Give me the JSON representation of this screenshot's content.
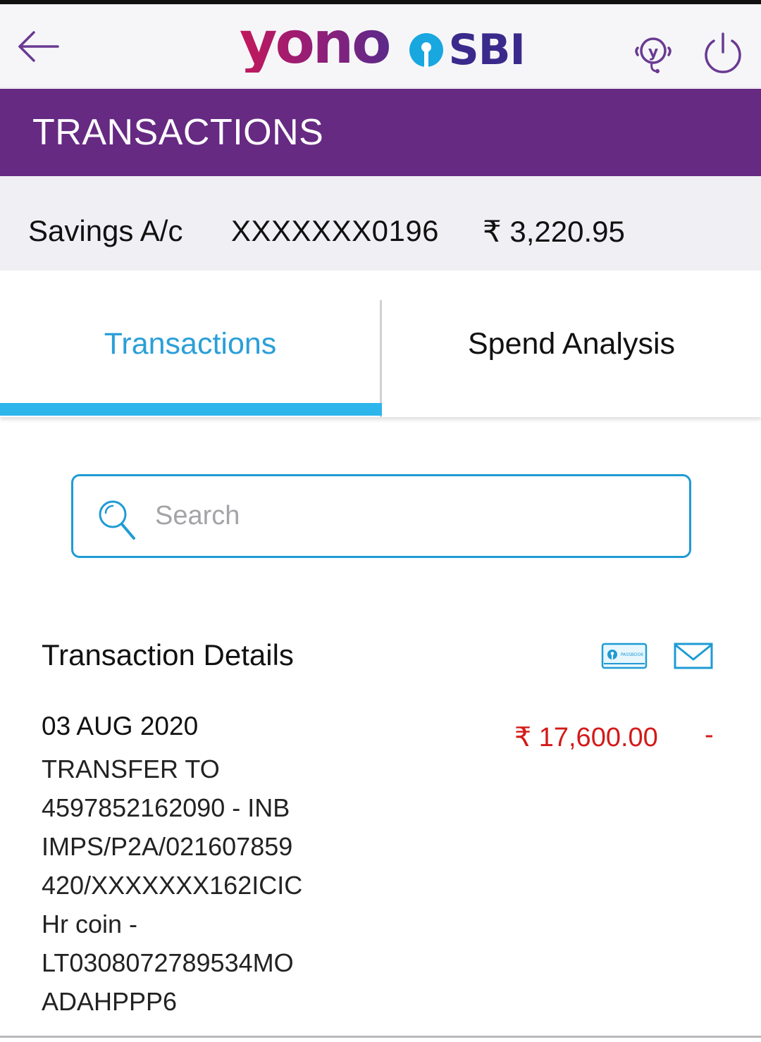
{
  "header": {
    "logo_text": "yono",
    "bank_text": "SBI",
    "icons": [
      "back-arrow-icon",
      "yono-help-icon",
      "power-icon"
    ],
    "accent_color": "#662a82"
  },
  "page_title": "TRANSACTIONS",
  "account": {
    "type": "Savings A/c",
    "number": "XXXXXXX0196",
    "balance": "₹ 3,220.95"
  },
  "tabs": [
    {
      "label": "Transactions",
      "active": true
    },
    {
      "label": "Spend Analysis",
      "active": false
    }
  ],
  "search": {
    "placeholder": "Search",
    "value": ""
  },
  "details": {
    "title": "Transaction Details",
    "icons": [
      "passbook-icon",
      "mail-icon"
    ],
    "passbook_icon_text": "PASSBOOK"
  },
  "transactions": [
    {
      "date": "03 AUG 2020",
      "description": "TRANSFER TO\n4597852162090 - INB\nIMPS/P2A/021607859\n420/XXXXXXX162ICIC\nHr coin -\nLT0308072789534MO\nADAHPPP6",
      "amount": "₹ 17,600.00",
      "sign": "-",
      "amount_color": "#d31a1a"
    }
  ]
}
